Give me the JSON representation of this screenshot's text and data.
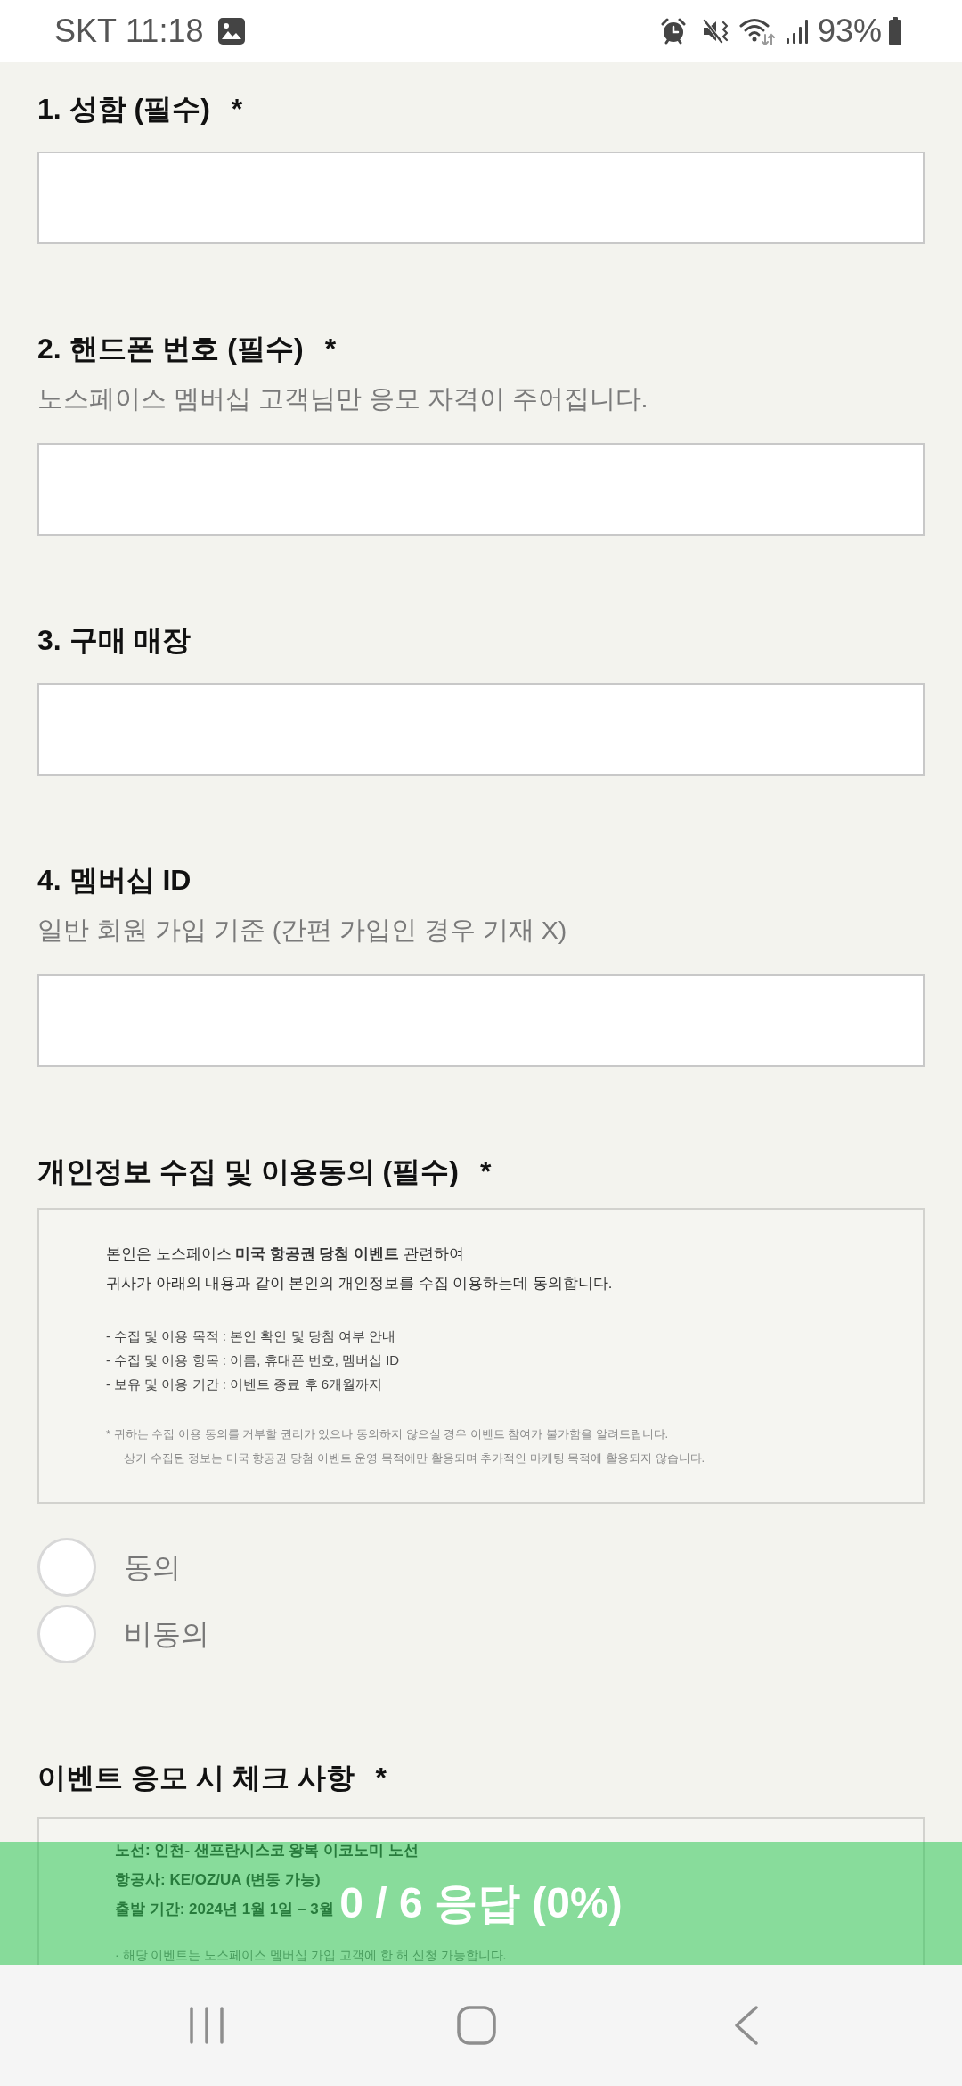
{
  "status_bar": {
    "carrier": "SKT",
    "time": "11:18",
    "battery": "93%"
  },
  "questions": [
    {
      "kind": "text",
      "title": "1. 성함 (필수)",
      "required_mark": "*"
    },
    {
      "kind": "text",
      "title": "2. 핸드폰 번호 (필수)",
      "required_mark": "*",
      "description": "노스페이스 멤버십 고객님만 응모 자격이 주어집니다."
    },
    {
      "kind": "text",
      "title": "3. 구매 매장"
    },
    {
      "kind": "text",
      "title": "4. 멤버십 ID",
      "description": "일반 회원 가입 기준 (간편 가입인 경우 기재 X)"
    },
    {
      "kind": "choice",
      "title": "개인정보 수집 및 이용동의 (필수)",
      "required_mark": "*",
      "notice": [
        {
          "kind": "intro",
          "lines": [
            "본인은 노스페이스 **미국 항공권 당첨 이벤트** 관련하여",
            "귀사가 아래의 내용과 같이 본인의 개인정보를 수집 이용하는데 동의합니다."
          ]
        },
        {
          "kind": "list",
          "lines": [
            "- 수집 및 이용 목적 : 본인 확인 및 당첨 여부 안내",
            "- 수집 및 이용 항목 : 이름, 휴대폰 번호, 멤버십 ID",
            "- 보유 및 이용 기간 : 이벤트 종료 후 6개월까지"
          ]
        },
        {
          "kind": "footnote",
          "lines": [
            "* 귀하는 수집 이용 동의를 거부할 권리가 있으나 동의하지 않으실 경우 이벤트 참여가 불가함을 알려드립니다.",
            "상기 수집된 정보는 미국 항공권 당첨 이벤트 운영 목적에만 활용되며 추가적인 마케팅 목적에 활용되지 않습니다."
          ]
        }
      ],
      "options": [
        {
          "label": "동의",
          "selected": false
        },
        {
          "label": "비동의",
          "selected": false
        }
      ]
    },
    {
      "kind": "notice",
      "title": "이벤트 응모 시 체크 사항",
      "required_mark": "*",
      "notice": [
        {
          "kind": "highlight",
          "lines": [
            "노선: 인천- 샌프란시스코 왕복 이코노미 노선",
            "항공사: KE/OZ/UA (변동 가능)",
            "출발 기간: 2024년 1월 1일 – 3월"
          ]
        },
        {
          "kind": "remark",
          "lines": [
            "· 해당 이벤트는 노스페이스 멤버십 가입 고객에 한 해 신청 가능합니다."
          ]
        }
      ]
    }
  ],
  "progress": {
    "text": "0 / 6 응답 (0%)"
  }
}
